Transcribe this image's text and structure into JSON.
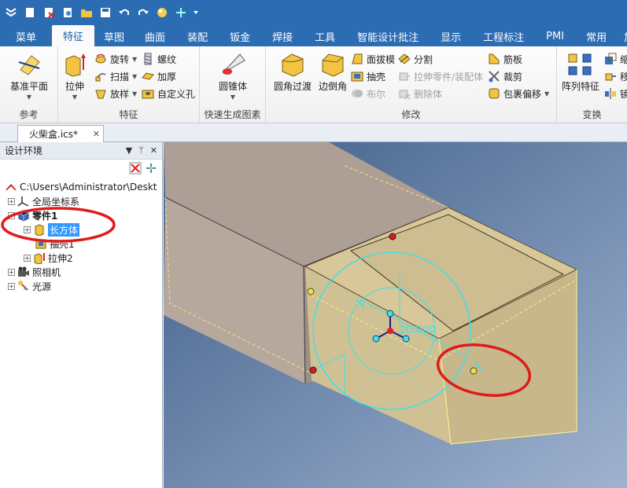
{
  "quick_access": {
    "icons": [
      "app-menu-icon",
      "new-icon",
      "close-doc-icon",
      "open-icon",
      "folder-icon",
      "save-icon",
      "undo-icon",
      "redo-icon",
      "render-icon",
      "smart-icon",
      "dropdown-icon"
    ]
  },
  "tabs": [
    {
      "label": "菜单",
      "active": false
    },
    {
      "label": "特征",
      "active": true
    },
    {
      "label": "草图",
      "active": false
    },
    {
      "label": "曲面",
      "active": false
    },
    {
      "label": "装配",
      "active": false
    },
    {
      "label": "钣金",
      "active": false
    },
    {
      "label": "焊接",
      "active": false
    },
    {
      "label": "工具",
      "active": false
    },
    {
      "label": "智能设计批注",
      "active": false
    },
    {
      "label": "显示",
      "active": false
    },
    {
      "label": "工程标注",
      "active": false
    },
    {
      "label": "PMI",
      "active": false
    },
    {
      "label": "常用",
      "active": false
    },
    {
      "label": "加载",
      "active": false
    }
  ],
  "ribbon": {
    "ref_group": {
      "label": "参考",
      "datum_plane": "基准平面"
    },
    "feature_group": {
      "label": "特征",
      "extrude": "拉伸",
      "revolve": "旋转",
      "sweep": "扫描",
      "loft": "放样",
      "thread": "螺纹",
      "thicken": "加厚",
      "custom_hole": "自定义孔"
    },
    "quick_group": {
      "label": "快速生成图素",
      "cone": "圆锥体"
    },
    "modify_group": {
      "label": "修改",
      "fillet": "圆角过渡",
      "chamfer": "边倒角",
      "draft": "面拔模",
      "shell": "抽壳",
      "boolean": "布尔",
      "split": "分割",
      "stretch_part": "拉伸零件/装配体",
      "delete_body": "删除体",
      "rib": "筋板",
      "trim": "裁剪",
      "wrap_offset": "包裹偏移"
    },
    "transform_group": {
      "label": "变换",
      "pattern": "阵列特征",
      "scale": "缩",
      "mirror": "镜",
      "other": "移"
    }
  },
  "document": {
    "tab_name": "火柴盒.ics*"
  },
  "design_env": {
    "title": "设计环境",
    "tree": [
      {
        "label": "C:\\Users\\Administrator\\Deskt",
        "level": 0,
        "icon": "scene-icon"
      },
      {
        "label": "全局坐标系",
        "level": 1,
        "icon": "axes-icon"
      },
      {
        "label": "零件1",
        "level": 1,
        "icon": "part-icon",
        "bold": true
      },
      {
        "label": "长方体",
        "level": 2,
        "icon": "box-icon",
        "selected": true
      },
      {
        "label": "抽壳1",
        "level": 2,
        "icon": "shell-icon"
      },
      {
        "label": "拉伸2",
        "level": 2,
        "icon": "extrude-icon"
      },
      {
        "label": "照相机",
        "level": 1,
        "icon": "camera-icon"
      },
      {
        "label": "光源",
        "level": 1,
        "icon": "light-icon"
      }
    ]
  },
  "viewport": {
    "dimension_label": "20.000",
    "background_colors": [
      "#3e5d88",
      "#8fa6c4"
    ],
    "outer_box_color": "#b2a49a",
    "inner_box_color": "#d8c79a",
    "annotation_color": "#e01b1b"
  }
}
